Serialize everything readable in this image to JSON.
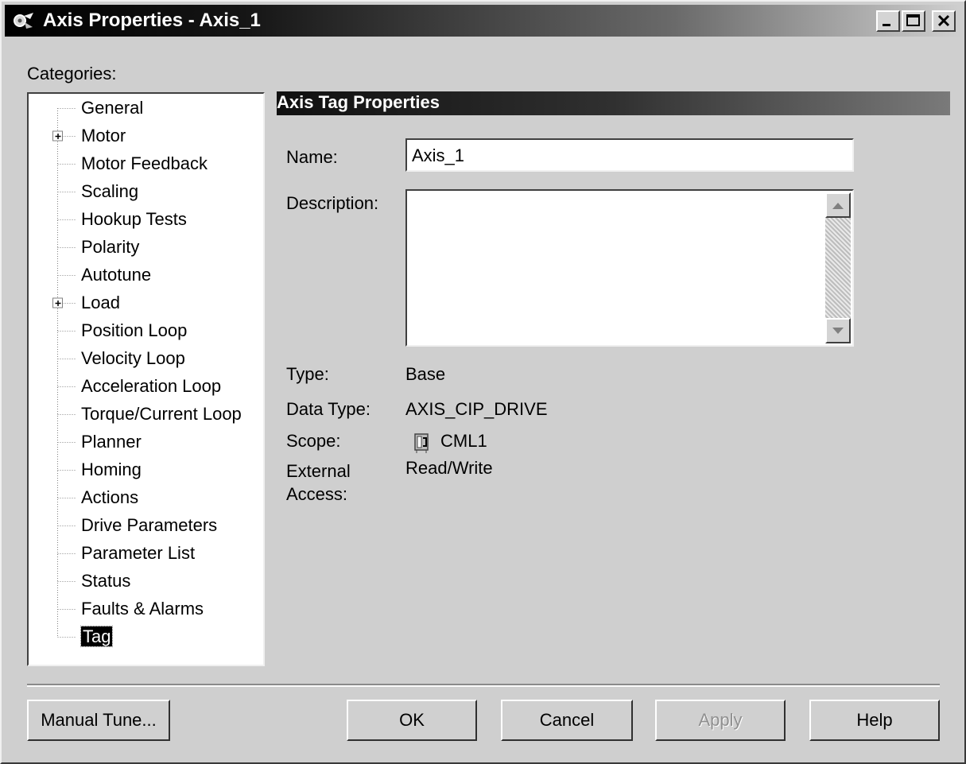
{
  "window": {
    "title": "Axis Properties - Axis_1"
  },
  "categories_label": "Categories:",
  "tree": {
    "items": [
      {
        "label": "General",
        "expandable": false
      },
      {
        "label": "Motor",
        "expandable": true
      },
      {
        "label": "Motor Feedback",
        "expandable": false
      },
      {
        "label": "Scaling",
        "expandable": false
      },
      {
        "label": "Hookup Tests",
        "expandable": false
      },
      {
        "label": "Polarity",
        "expandable": false
      },
      {
        "label": "Autotune",
        "expandable": false
      },
      {
        "label": "Load",
        "expandable": true
      },
      {
        "label": "Position Loop",
        "expandable": false
      },
      {
        "label": "Velocity Loop",
        "expandable": false
      },
      {
        "label": "Acceleration Loop",
        "expandable": false
      },
      {
        "label": "Torque/Current Loop",
        "expandable": false
      },
      {
        "label": "Planner",
        "expandable": false
      },
      {
        "label": "Homing",
        "expandable": false
      },
      {
        "label": "Actions",
        "expandable": false
      },
      {
        "label": "Drive Parameters",
        "expandable": false
      },
      {
        "label": "Parameter List",
        "expandable": false
      },
      {
        "label": "Status",
        "expandable": false
      },
      {
        "label": "Faults & Alarms",
        "expandable": false
      },
      {
        "label": "Tag",
        "expandable": false,
        "selected": true
      }
    ]
  },
  "section": {
    "title": "Axis Tag Properties"
  },
  "form": {
    "name_label": "Name:",
    "name_value": "Axis_1",
    "description_label": "Description:",
    "description_value": "",
    "type_label": "Type:",
    "type_value": "Base",
    "data_type_label": "Data Type:",
    "data_type_value": "AXIS_CIP_DRIVE",
    "scope_label": "Scope:",
    "scope_value": "CML1",
    "scope_icon": "controller-icon",
    "external_access_label_line1": "External",
    "external_access_label_line2": "Access:",
    "external_access_value": "Read/Write"
  },
  "buttons": {
    "manual_tune": "Manual Tune...",
    "ok": "OK",
    "cancel": "Cancel",
    "apply": "Apply",
    "help": "Help"
  },
  "colors": {
    "window_bg": "#cfcfcf",
    "title_fg": "#ffffff",
    "disabled_text": "#909090"
  }
}
